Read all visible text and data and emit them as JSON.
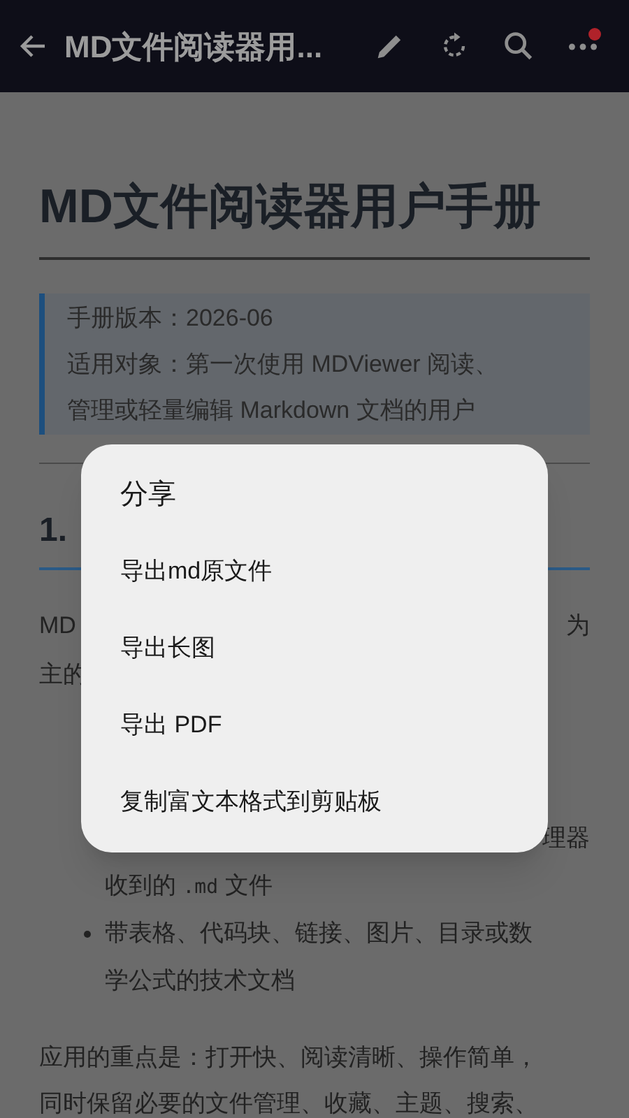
{
  "app_bar": {
    "title": "MD文件阅读器用...",
    "more_badge": true
  },
  "document": {
    "title": "MD文件阅读器用户手册",
    "blockquote": [
      "手册版本：2026-06",
      "适用对象：第一次使用 MDViewer 阅读、",
      "管理或轻量编辑 Markdown 文档的用户"
    ],
    "heading": "1.",
    "paragraph_fragments": [
      {
        "left": "MD",
        "right": "为"
      },
      {
        "left": "主的"
      }
    ],
    "list_fragment": {
      "right": "理器"
    },
    "list_lines": [
      {
        "kind": "continuation",
        "segments": [
          {
            "kind": "text",
            "text": "收到的 "
          },
          {
            "kind": "code",
            "text": ".md"
          },
          {
            "kind": "text",
            "text": " 文件"
          }
        ]
      },
      {
        "kind": "bullet",
        "segments": [
          {
            "kind": "text",
            "text": "带表格、代码块、链接、图片、目录或数"
          }
        ]
      },
      {
        "kind": "continuation",
        "segments": [
          {
            "kind": "text",
            "text": "学公式的技术文档"
          }
        ]
      }
    ],
    "closing": [
      "应用的重点是：打开快、阅读清晰、操作简单，",
      "同时保留必要的文件管理、收藏、主题、搜索、"
    ]
  },
  "share_dialog": {
    "title": "分享",
    "items": [
      "导出md原文件",
      "导出长图",
      "导出 PDF",
      "复制富文本格式到剪贴板"
    ]
  }
}
